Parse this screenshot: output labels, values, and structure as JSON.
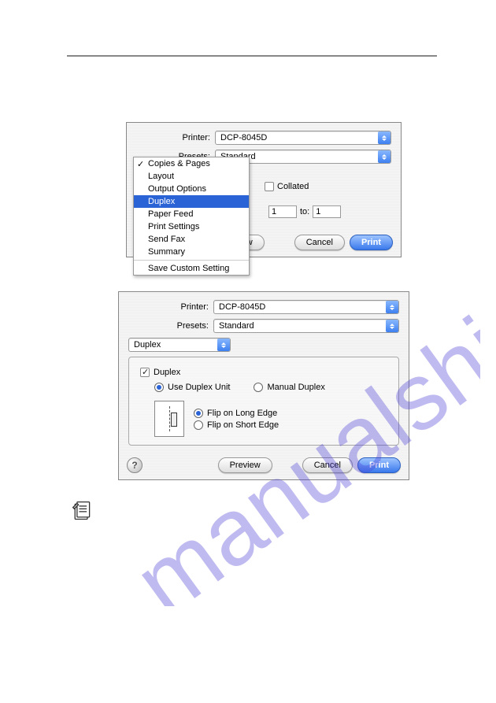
{
  "watermark": "manualshive.com",
  "dialog1": {
    "printer_label": "Printer:",
    "printer_value": "DCP-8045D",
    "presets_label": "Presets:",
    "presets_value": "Standard",
    "menu": {
      "items": [
        {
          "label": "Copies & Pages",
          "checked": true,
          "selected": false
        },
        {
          "label": "Layout",
          "checked": false,
          "selected": false
        },
        {
          "label": "Output Options",
          "checked": false,
          "selected": false
        },
        {
          "label": "Duplex",
          "checked": false,
          "selected": true
        },
        {
          "label": "Paper Feed",
          "checked": false,
          "selected": false
        },
        {
          "label": "Print Settings",
          "checked": false,
          "selected": false
        },
        {
          "label": "Send Fax",
          "checked": false,
          "selected": false
        },
        {
          "label": "Summary",
          "checked": false,
          "selected": false
        }
      ],
      "save_custom": "Save Custom Setting"
    },
    "collated_label": "Collated",
    "from_value": "1",
    "to_label": "to:",
    "to_value": "1",
    "preview": "Preview",
    "cancel": "Cancel",
    "print": "Print"
  },
  "dialog2": {
    "printer_label": "Printer:",
    "printer_value": "DCP-8045D",
    "presets_label": "Presets:",
    "presets_value": "Standard",
    "pane_select": "Duplex",
    "duplex_check": "Duplex",
    "use_duplex_unit": "Use Duplex Unit",
    "manual_duplex": "Manual Duplex",
    "flip_long": "Flip on Long Edge",
    "flip_short": "Flip on Short Edge",
    "preview": "Preview",
    "cancel": "Cancel",
    "print": "Print"
  }
}
